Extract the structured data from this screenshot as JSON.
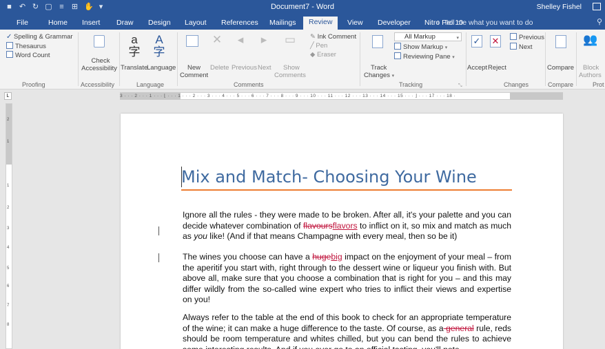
{
  "title_bar": {
    "document_title": "Document7  -  Word",
    "user_name": "Shelley Fishel"
  },
  "tabs": [
    {
      "label": "File"
    },
    {
      "label": "Home"
    },
    {
      "label": "Insert"
    },
    {
      "label": "Draw"
    },
    {
      "label": "Design"
    },
    {
      "label": "Layout"
    },
    {
      "label": "References"
    },
    {
      "label": "Mailings"
    },
    {
      "label": "Review"
    },
    {
      "label": "View"
    },
    {
      "label": "Developer"
    },
    {
      "label": "Nitro Pro 10"
    }
  ],
  "active_tab": "Review",
  "tell_me": "Tell me what you want to do",
  "ribbon": {
    "proofing": {
      "spelling": "Spelling & Grammar",
      "thesaurus": "Thesaurus",
      "word_count": "Word Count",
      "label": "Proofing"
    },
    "accessibility": {
      "check_line1": "Check",
      "check_line2": "Accessibility",
      "label": "Accessibility"
    },
    "language": {
      "translate": "Translate",
      "language": "Language",
      "label": "Language"
    },
    "comments": {
      "new_line1": "New",
      "new_line2": "Comment",
      "delete": "Delete",
      "previous": "Previous",
      "next": "Next",
      "show_line1": "Show",
      "show_line2": "Comments",
      "ink_comment": "Ink Comment",
      "pen": "Pen",
      "eraser": "Eraser",
      "label": "Comments"
    },
    "tracking": {
      "track_line1": "Track",
      "track_line2": "Changes",
      "all_markup": "All Markup",
      "show_markup": "Show Markup",
      "reviewing_pane": "Reviewing Pane",
      "label": "Tracking"
    },
    "changes": {
      "accept": "Accept",
      "reject": "Reject",
      "previous": "Previous",
      "next": "Next",
      "label": "Changes"
    },
    "compare": {
      "compare": "Compare",
      "label": "Compare"
    },
    "protect": {
      "block_line1": "Block",
      "block_line2": "Authors",
      "label": "Prot"
    }
  },
  "ruler_numbers": "3 · · · 2 · · · 1 · · · ⌊ · · · 1 · · · 2 · · · 3 · · · 4 · · · 5 · · · 6 · · · 7 · · · 8 · · · 9 · · · 10 · · · 11 · · · 12 · · · 13 · · · 14 · · · 15 · · · ⌋ · · · 17 · · · 18 ·",
  "vruler_numbers": [
    "2",
    "1",
    "1",
    "2",
    "3",
    "4",
    "5",
    "6",
    "7",
    "8"
  ],
  "document": {
    "heading": "Mix and Match- Choosing Your Wine",
    "p1": {
      "a": "Ignore all the rules - they were made to be broken.  After all, it's your palette and you can decide whatever combination of ",
      "del": "flavours",
      "ins": "flavors",
      "b": " to inflict on it, so mix and match as much as ",
      "em": "you",
      "c": " like! (And if that means Champagne with every meal, then so be it)"
    },
    "p2": {
      "a": "The wines you choose can have a ",
      "del": "huge",
      "ins": "big",
      "b": " impact on the enjoyment of your meal – from the aperitif you start with, right through to the dessert wine or liqueur you finish with.  But above all, make sure that you choose a combination that is right for you – and this may differ wildly from the so-called wine expert who tries to inflict their views and expertise on you!"
    },
    "p3": {
      "a": "Always refer to the table at the end of this book to check for an appropriate temperature of the wine; it can make a huge difference to the taste.  Of course, as a",
      "del": " general",
      "b": " rule, reds should be room temperature and whites chilled, but you can bend the rules to achieve some interesting results.  And if you ever go to an official tasting, you'll note"
    }
  }
}
